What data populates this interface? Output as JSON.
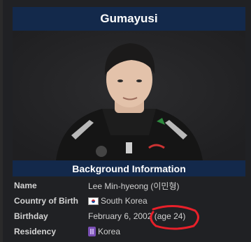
{
  "infobox": {
    "title": "Gumayusi",
    "section_title": "Background Information",
    "rows": [
      {
        "label": "Name",
        "value": "Lee Min-hyeong (이민형)"
      },
      {
        "label": "Country of Birth",
        "value": "South Korea",
        "icon": "south-korea-flag-icon"
      },
      {
        "label": "Birthday",
        "value": "February 6, 2002 (age 24)"
      },
      {
        "label": "Residency",
        "value": "Korea",
        "icon": "lck-region-icon"
      }
    ]
  },
  "colors": {
    "header_bg": "#13294b",
    "panel_bg": "#202124",
    "annotation": "#e8202a"
  }
}
